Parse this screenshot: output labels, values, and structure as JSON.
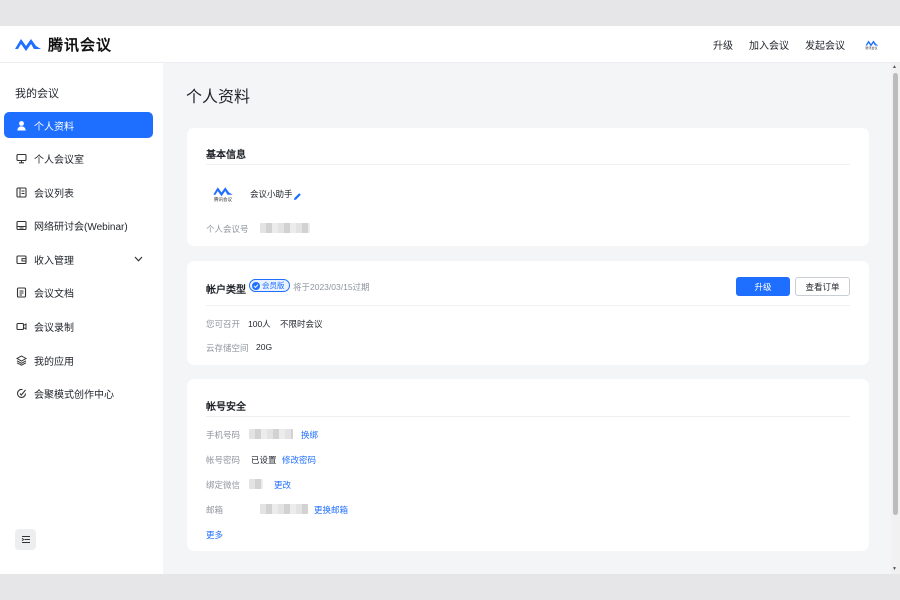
{
  "app": {
    "name": "腾讯会议"
  },
  "header": {
    "links": [
      "升级",
      "加入会议",
      "发起会议"
    ],
    "avatar_text": "腾讯会议"
  },
  "sidebar": {
    "title": "我的会议",
    "items": [
      {
        "label": "个人资料",
        "icon": "user-icon",
        "active": true
      },
      {
        "label": "个人会议室",
        "icon": "monitor-icon"
      },
      {
        "label": "会议列表",
        "icon": "list-icon"
      },
      {
        "label": "网络研讨会(Webinar)",
        "icon": "webinar-icon"
      },
      {
        "label": "收入管理",
        "icon": "wallet-icon",
        "expandable": true
      },
      {
        "label": "会议文档",
        "icon": "document-icon"
      },
      {
        "label": "会议录制",
        "icon": "recording-icon"
      },
      {
        "label": "我的应用",
        "icon": "apps-icon"
      },
      {
        "label": "会聚模式创作中心",
        "icon": "creation-icon"
      }
    ]
  },
  "main": {
    "title": "个人资料",
    "basic": {
      "title": "基本信息",
      "nickname": "会议小助手",
      "avatar_text": "腾讯会议",
      "meeting_id_label": "个人会议号"
    },
    "account": {
      "title": "帐户类型",
      "badge": "会员版",
      "expiry": "将于2023/03/15过期",
      "upgrade_button": "升级",
      "orders_button": "查看订单",
      "capacity_label": "您可召开",
      "capacity_value": "100人",
      "duration_value": "不限时会议",
      "storage_label": "云存储空间",
      "storage_value": "20G"
    },
    "security": {
      "title": "帐号安全",
      "phone_label": "手机号码",
      "phone_action": "换绑",
      "password_label": "帐号密码",
      "password_status": "已设置",
      "password_action": "修改密码",
      "wechat_label": "绑定微信",
      "wechat_action": "更改",
      "email_label": "邮箱",
      "email_action": "更换邮箱",
      "more": "更多"
    }
  },
  "colors": {
    "accent": "#1e6fff",
    "background": "#f4f5f7"
  }
}
